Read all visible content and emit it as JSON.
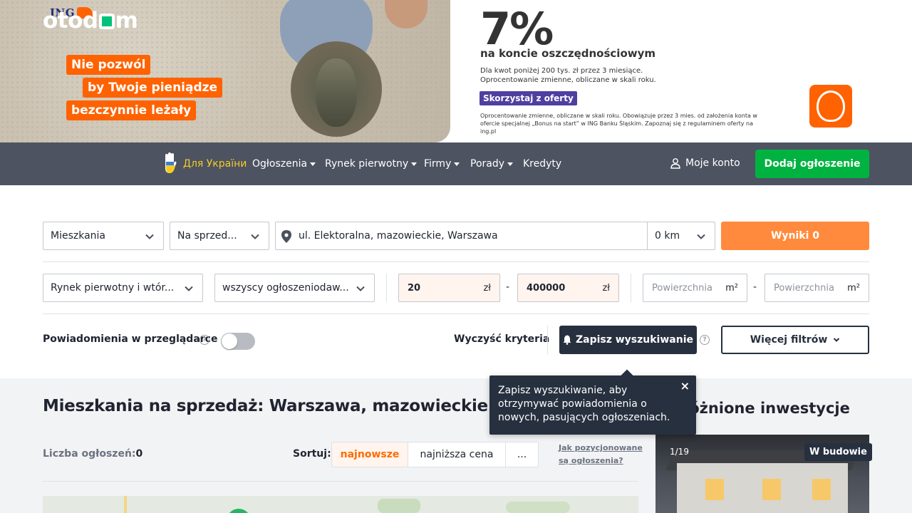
{
  "banner": {
    "ing_logo": "ING",
    "slogan": [
      "Nie pozwól",
      "by Twoje pieniądze",
      "bezczynnie leżały"
    ],
    "rate": "7%",
    "rate_sub": "na koncie oszczędnościowym",
    "note": "Dla kwot poniżej 200 tys. zł przez 3 miesiące. Oprocentowanie zmienne, obliczane w skali roku.",
    "cta": "Skorzystaj z oferty",
    "fine_print": "Oprocentowanie zmienne, obliczane w skali roku. Obowiązuje przez 3 mies. od założenia konta w ofercie specjalnej „Bonus na start” w ING Banku Śląskim. Zapoznaj się z regulaminem oferty na ing.pl",
    "brand_color": "#ff6200"
  },
  "nav": {
    "logo": "otodom",
    "ukraine_label": "Для України",
    "items": [
      {
        "label": "Ogłoszenia",
        "dropdown": true
      },
      {
        "label": "Rynek pierwotny",
        "dropdown": true
      },
      {
        "label": "Firmy",
        "dropdown": true
      },
      {
        "label": "Porady",
        "dropdown": true
      },
      {
        "label": "Kredyty",
        "dropdown": false
      }
    ],
    "account_label": "Moje konto",
    "add_listing": "Dodaj ogłoszenie",
    "background": "#4d5361",
    "accent": "#00b341"
  },
  "search": {
    "property_type": "Mieszkania",
    "transaction": "Na sprzed...",
    "location": "ul. Elektoralna, mazowieckie, Warszawa",
    "radius": "0 km",
    "results_label": "Wyniki 0",
    "market": "Rynek pierwotny i wtór...",
    "advertiser": "wszyscy ogłoszeniodaw...",
    "price_from": "20",
    "price_to": "400000",
    "price_unit": "zł",
    "area_placeholder": "Powierzchnia",
    "area_unit": "m²",
    "range_dash": "-",
    "notifications_label": "Powiadomienia w przeglądarce",
    "notifications_on": false,
    "clear_label": "Wyczyść kryteria",
    "save_label": "Zapisz wyszukiwanie",
    "more_filters": "Więcej filtrów",
    "help_glyph": "?"
  },
  "tooltip": {
    "text": "Zapisz wyszukiwanie, aby otrzymywać powiadomienia o nowych, pasujących ogłoszeniach.",
    "close": "×"
  },
  "listing": {
    "title": "Mieszkania na sprzedaż: Warszawa, mazowieckie",
    "count_label": "Liczba ogłoszeń:",
    "count_value": "0",
    "sort_label": "Sortuj:",
    "sort_options": [
      "najnowsze",
      "najniższa cena",
      "..."
    ],
    "sort_active": 0,
    "how_link": "Jak pozycjonowane są ogłoszenia?"
  },
  "sidebar": {
    "title": "Wyróżnione inwestycje",
    "card": {
      "photo_counter": "1/19",
      "status": "W budowie"
    }
  }
}
